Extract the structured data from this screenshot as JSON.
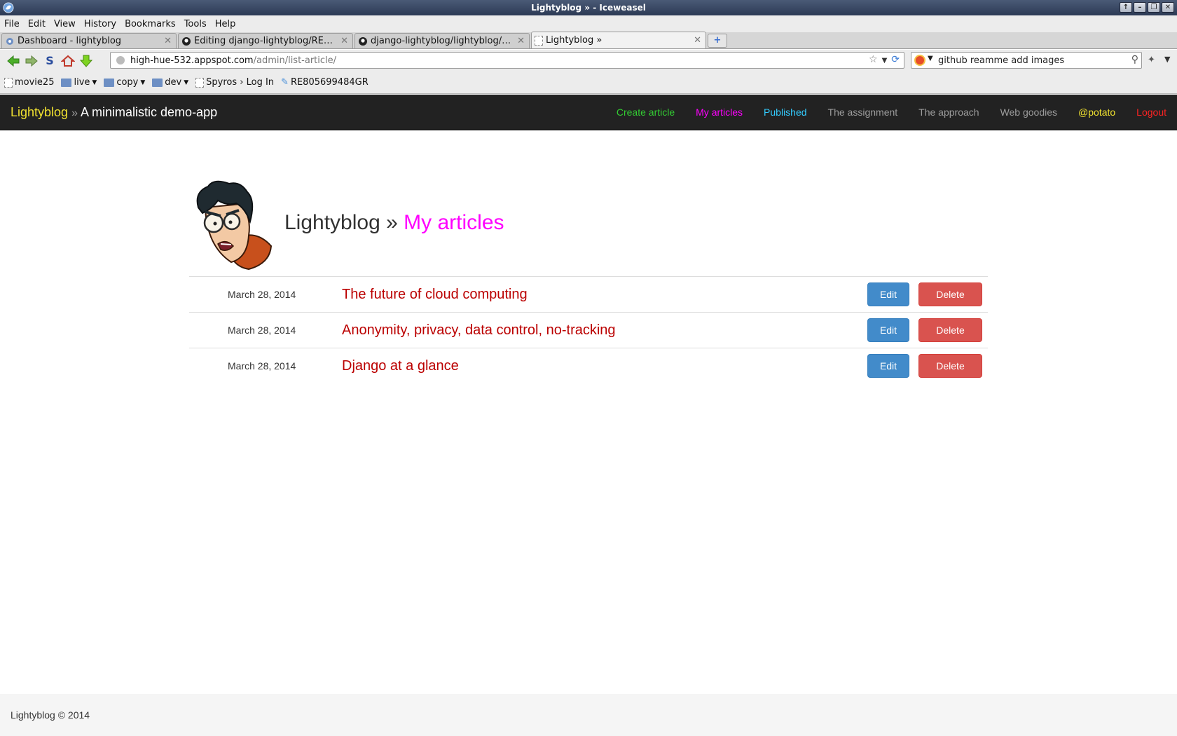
{
  "window": {
    "title": "Lightyblog » - Iceweasel",
    "buttons": [
      "↑",
      "–",
      "❐",
      "✕"
    ]
  },
  "menu": [
    "File",
    "Edit",
    "View",
    "History",
    "Bookmarks",
    "Tools",
    "Help"
  ],
  "tabs": [
    {
      "label": "Dashboard - lightyblog",
      "icon": "appengine-icon"
    },
    {
      "label": "Editing django-lightyblog/RE…",
      "icon": "github-icon"
    },
    {
      "label": "django-lightyblog/lightyblog/…",
      "icon": "github-icon"
    },
    {
      "label": "Lightyblog »",
      "icon": "page-icon",
      "active": true
    }
  ],
  "toolbar": {
    "url_host": "high-hue-532.appspot.com",
    "url_path": "/admin/list-article/",
    "search_value": "github reamme add images"
  },
  "bookmarks": [
    {
      "label": "movie25",
      "type": "page"
    },
    {
      "label": "live",
      "type": "folder"
    },
    {
      "label": "copy",
      "type": "folder"
    },
    {
      "label": "dev",
      "type": "folder"
    },
    {
      "label": "Spyros › Log In",
      "type": "page"
    },
    {
      "label": "RE805699484GR",
      "type": "link"
    }
  ],
  "site": {
    "brand_name": "Lightyblog",
    "brand_sep": "»",
    "brand_sub": "A minimalistic demo-app",
    "nav": [
      {
        "label": "Create article",
        "color": "#33cc33"
      },
      {
        "label": "My articles",
        "color": "#ff00ff"
      },
      {
        "label": "Published",
        "color": "#33ccff"
      },
      {
        "label": "The assignment",
        "color": "#9d9d9d"
      },
      {
        "label": "The approach",
        "color": "#9d9d9d"
      },
      {
        "label": "Web goodies",
        "color": "#9d9d9d"
      },
      {
        "label": "@potato",
        "color": "#f0e130"
      },
      {
        "label": "Logout",
        "color": "#ff2222"
      }
    ]
  },
  "page": {
    "title_main": "Lightyblog",
    "title_sep": "»",
    "title_accent": "My articles"
  },
  "articles": [
    {
      "date": "March 28, 2014",
      "title": "The future of cloud computing",
      "edit": "Edit",
      "delete": "Delete"
    },
    {
      "date": "March 28, 2014",
      "title": "Anonymity, privacy, data control, no-tracking",
      "edit": "Edit",
      "delete": "Delete"
    },
    {
      "date": "March 28, 2014",
      "title": "Django at a glance",
      "edit": "Edit",
      "delete": "Delete"
    }
  ],
  "footer": {
    "text": "Lightyblog © 2014"
  }
}
